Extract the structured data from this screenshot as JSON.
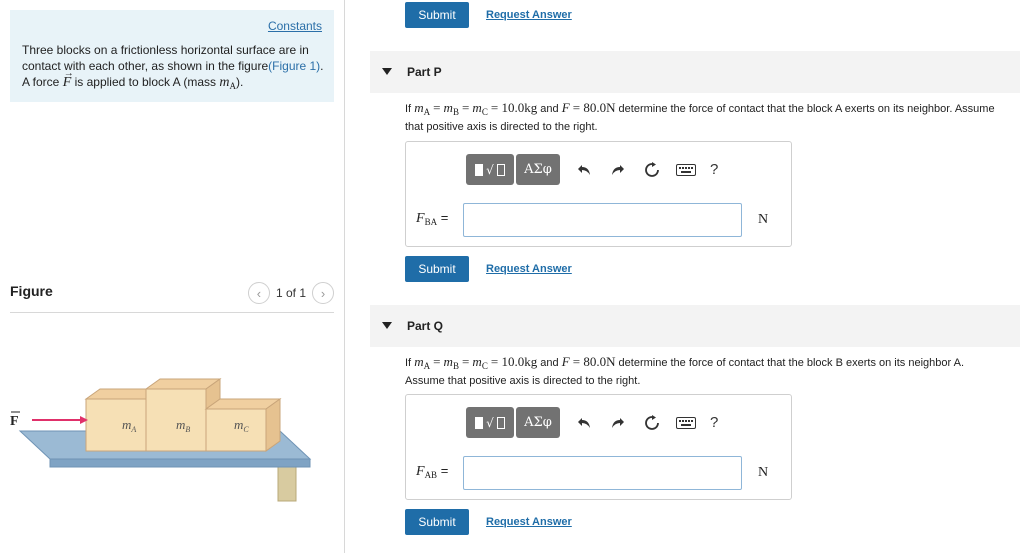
{
  "intro": {
    "constants_link": "Constants",
    "text_1": "Three blocks on a frictionless horizontal surface are in contact with each other, as shown in the figure",
    "figure_link": "(Figure 1)",
    "text_2": ".",
    "text_3": "A force",
    "force_symbol": "F",
    "text_4": "is applied to block A (mass",
    "mass_symbol": "m",
    "mass_sub": "A",
    "text_5": ")."
  },
  "figure": {
    "heading": "Figure",
    "pager_text": "1 of 1",
    "prev_icon": "chevron-left-icon",
    "next_icon": "chevron-right-icon",
    "force_label": "F",
    "block_labels": [
      {
        "symbol": "m",
        "sub": "A"
      },
      {
        "symbol": "m",
        "sub": "B"
      },
      {
        "symbol": "m",
        "sub": "C"
      }
    ],
    "colors": {
      "block_face": "#f6e0b5",
      "block_top": "#f0cfa0",
      "block_side": "#e6c290",
      "surface": "#9bbad4",
      "surface_edge": "#6f93b5",
      "table_leg": "#d8cba0",
      "force_arrow": "#e0306a"
    }
  },
  "top_actions": {
    "submit": "Submit",
    "request": "Request Answer"
  },
  "parts": [
    {
      "title": "Part P",
      "q_prefix": "If",
      "eq_vars": "m",
      "eq_text": "= 10.0kg",
      "force_eq": "= 80.0N",
      "q_mid": "and",
      "q_suffix": "determine the force of contact that the block A exerts on its neighbor. Assume that positive axis is directed to the right.",
      "answer_label_symbol": "F",
      "answer_label_sub": "BA",
      "answer_equals": "=",
      "answer_value": "",
      "unit": "N",
      "greek_label": "ΑΣφ",
      "help": "?",
      "submit": "Submit",
      "request": "Request Answer"
    },
    {
      "title": "Part Q",
      "q_prefix": "If",
      "eq_vars": "m",
      "eq_text": "= 10.0kg",
      "force_eq": "= 80.0N",
      "q_mid": "and",
      "q_suffix": "determine the force of contact that the block B exerts on its neighbor A. Assume that positive axis is directed to the right.",
      "answer_label_symbol": "F",
      "answer_label_sub": "AB",
      "answer_equals": "=",
      "answer_value": "",
      "unit": "N",
      "greek_label": "ΑΣφ",
      "help": "?",
      "submit": "Submit",
      "request": "Request Answer"
    }
  ],
  "subs": {
    "a": "A",
    "b": "B",
    "c": "C",
    "eq": "="
  }
}
